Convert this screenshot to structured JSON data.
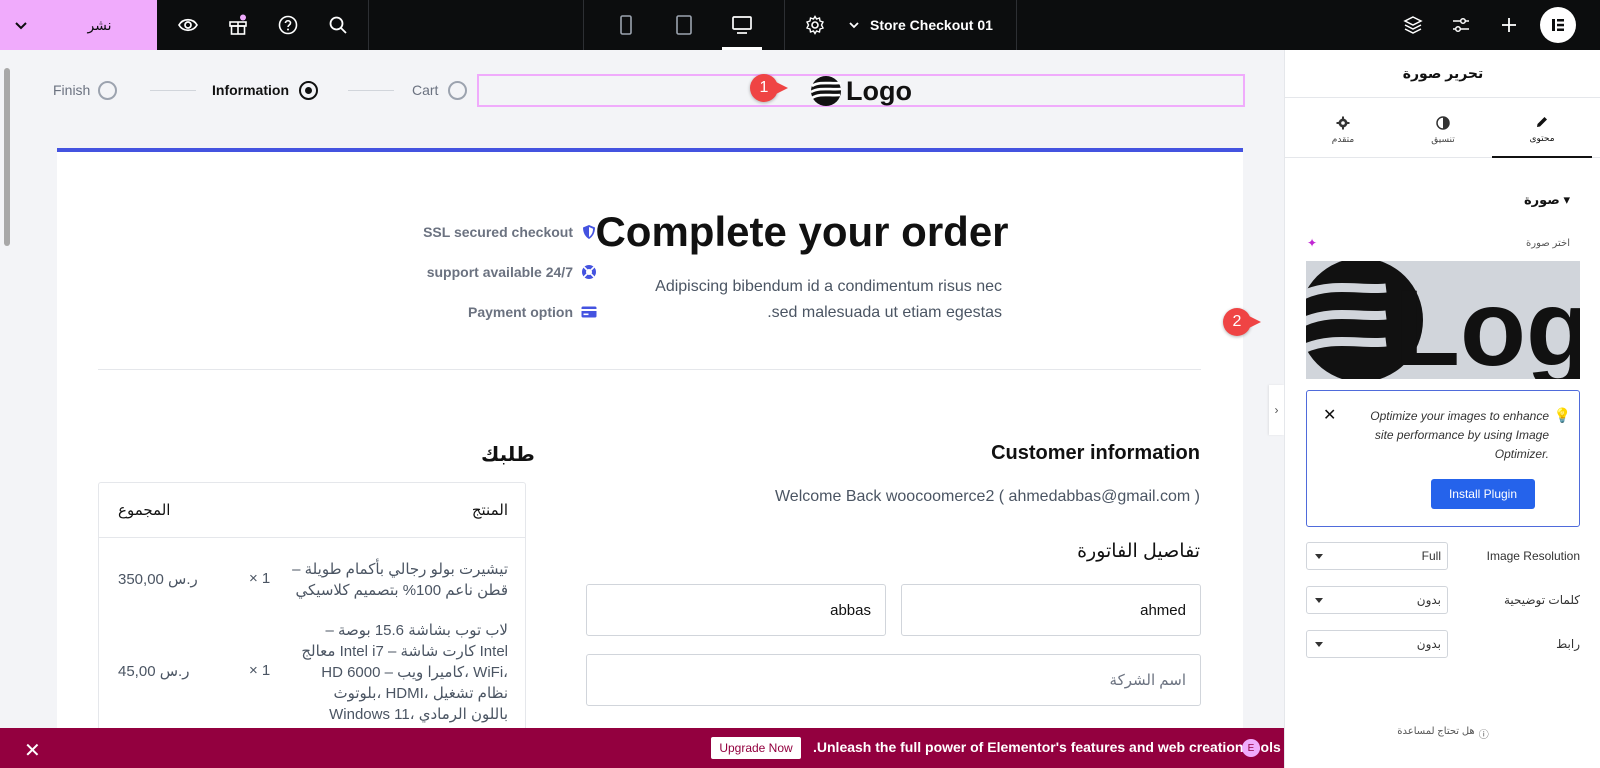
{
  "topbar": {
    "publish_label": "نشر",
    "document_title": "Store Checkout 01",
    "icons": [
      "chevron-down-icon",
      "eye-icon",
      "gift-icon",
      "help-icon",
      "search-icon",
      "mobile-icon",
      "tablet-icon",
      "desktop-icon",
      "settings-icon",
      "layers-icon",
      "sliders-icon",
      "plus-icon",
      "elementor-logo-icon"
    ]
  },
  "canvas": {
    "steps": [
      {
        "label": "Finish",
        "state": "pending"
      },
      {
        "label": "Information",
        "state": "current"
      },
      {
        "label": "Cart",
        "state": "pending"
      }
    ],
    "logo_text": "Logo",
    "badge1": "1",
    "badge2": "2",
    "features": [
      {
        "label": "SSL secured checkout",
        "icon": "shield-icon"
      },
      {
        "label": "support available 24/7",
        "icon": "lifebuoy-icon"
      },
      {
        "label": "Payment option",
        "icon": "credit-card-icon"
      }
    ],
    "heading": "Complete your order",
    "subtext_line1": "Adipiscing bibendum id a condimentum risus nec",
    "subtext_line2": ".sed malesuada ut etiam egestas",
    "customer_title": "Customer information",
    "welcome_text": "Welcome Back woocoomerce2 ( ahmedabbas@gmail.com )",
    "billing_title": "تفاصيل الفاتورة",
    "first_name_value": "ahmed",
    "last_name_value": "abbas",
    "company_placeholder": "اسم الشركة",
    "order_title": "طلبك",
    "order_headers": {
      "product": "المنتج",
      "total": "المجموع"
    },
    "order_items": [
      {
        "name": "تيشيرت بولو رجالي بأكمام طويلة – قطن ناعم 100% بتصميم كلاسيكي",
        "qty": "× 1",
        "price": "350,00 ر.س"
      },
      {
        "name": "لاب توب بشاشة 15.6 بوصة – معالج Intel i7 – كارت شاشة Intel HD 6000 – كاميرا ويب، WiFi، بلوتوث، HDMI، نظام تشغيل Windows 11، باللون الرمادي",
        "qty": "× 1",
        "price": "45,00 ر.س"
      }
    ]
  },
  "promo": {
    "text": ".Unleash the full power of Elementor's features and web creation tools",
    "button": "Upgrade Now"
  },
  "panel": {
    "title": "تحرير صورة",
    "tabs": [
      {
        "label": "محتوى",
        "icon": "pencil-icon",
        "active": true
      },
      {
        "label": "تنسيق",
        "icon": "contrast-icon",
        "active": false
      },
      {
        "label": "متقدم",
        "icon": "gear-icon",
        "active": false
      }
    ],
    "section_heading": "صورة",
    "choose_image_label": "اختر صورة",
    "optimize_text": "Optimize your images to enhance site performance by using Image Optimizer.",
    "install_button": "Install Plugin",
    "controls": [
      {
        "label": "Image Resolution",
        "value": "Full"
      },
      {
        "label": "كلمات توضيحية",
        "value": "بدون"
      },
      {
        "label": "رابط",
        "value": "بدون"
      }
    ],
    "help_text": "هل تحتاج لمساعدة"
  },
  "colors": {
    "topbar_bg": "#0c0d0e",
    "publish_bg": "#f0abfc",
    "accent_blue": "#4453e0",
    "promo_bg": "#93003f",
    "install_btn": "#2563eb",
    "badge_red": "#ef4444"
  }
}
